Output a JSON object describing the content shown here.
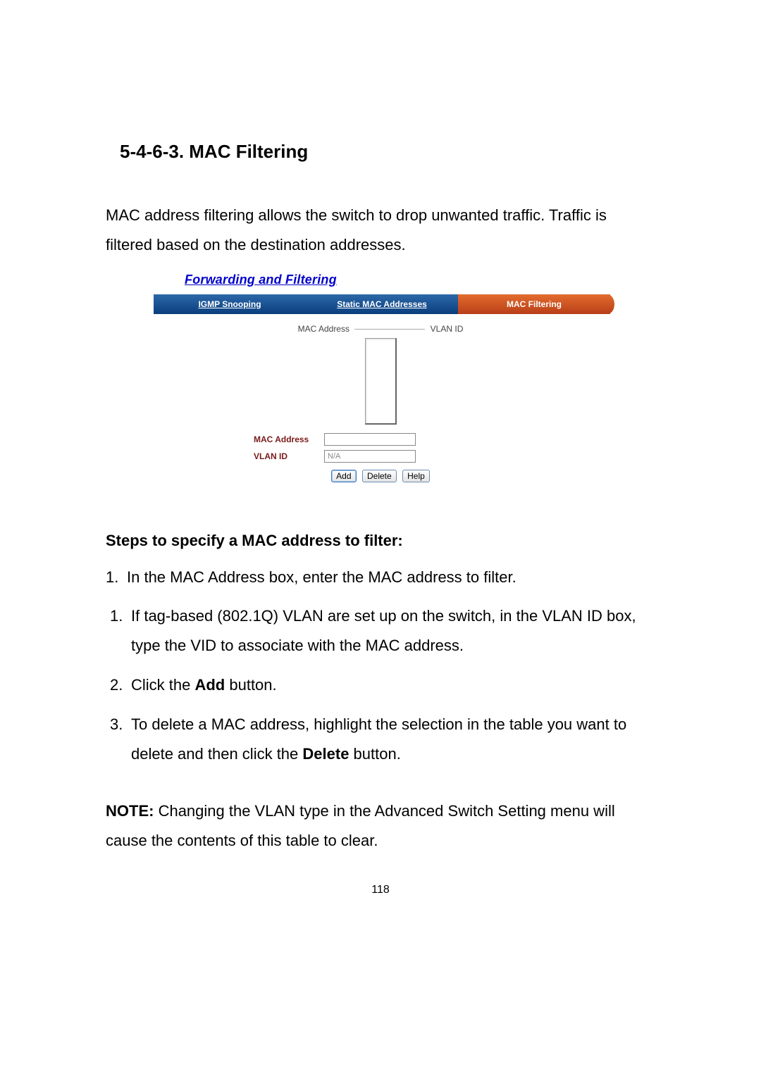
{
  "heading": "5-4-6-3. MAC Filtering",
  "intro": "MAC address filtering allows the switch to drop unwanted traffic. Traffic is filtered based on the destination addresses.",
  "screenshot": {
    "title": "Forwarding and Filtering",
    "tabs": [
      {
        "label": "IGMP Snooping",
        "active": false
      },
      {
        "label": "Static MAC Addresses",
        "active": false
      },
      {
        "label": "MAC Filtering",
        "active": true
      }
    ],
    "columns": {
      "left": "MAC Address",
      "right": "VLAN ID"
    },
    "fields": {
      "mac_label": "MAC Address",
      "mac_value": "",
      "vlan_label": "VLAN ID",
      "vlan_value": "N/A"
    },
    "buttons": {
      "add": "Add",
      "delete": "Delete",
      "help": "Help"
    }
  },
  "steps_heading": "Steps to specify a MAC address to filter:",
  "steps": [
    {
      "num": "1.",
      "text": "In the MAC Address box, enter the MAC address to filter."
    },
    {
      "num": "1.",
      "text_pre": "If tag-based (802.1Q) VLAN are set up on the switch, in the VLAN ID box, type the VID to associate with the MAC address."
    },
    {
      "num": "2.",
      "text_pre": "Click the ",
      "bold": "Add",
      "text_post": " button."
    },
    {
      "num": "3.",
      "text_pre": "To delete a MAC address, highlight the selection in the table you want to delete and then click the ",
      "bold": "Delete",
      "text_post": " button."
    }
  ],
  "note_label": "NOTE:",
  "note_text": " Changing the VLAN type in the Advanced Switch Setting menu will cause the contents of this table to clear.",
  "page_number": "118"
}
